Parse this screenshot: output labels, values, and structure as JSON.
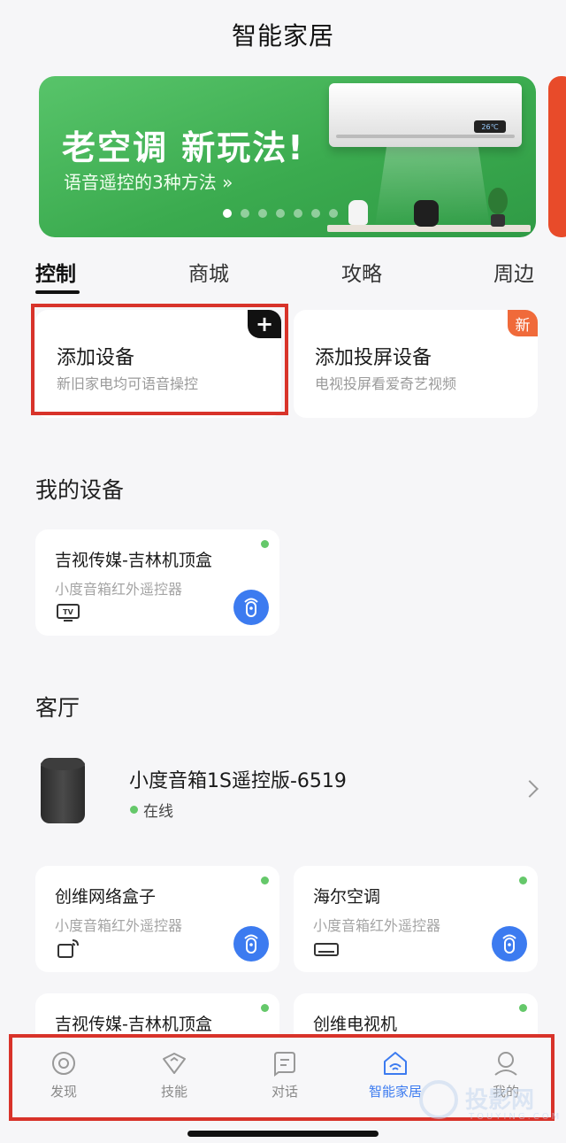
{
  "header": {
    "title": "智能家居"
  },
  "banner": {
    "title": "老空调 新玩法!",
    "subtitle": "语音遥控的3种方法 »",
    "ac_display": "26℃",
    "slide_count": 7,
    "active_slide": 1
  },
  "tabs": [
    {
      "label": "控制",
      "active": true
    },
    {
      "label": "商城",
      "active": false
    },
    {
      "label": "攻略",
      "active": false
    },
    {
      "label": "周边",
      "active": false
    }
  ],
  "quick_actions": {
    "add_device": {
      "title": "添加设备",
      "subtitle": "新旧家电均可语音操控",
      "badge": "+"
    },
    "add_screen": {
      "title": "添加投屏设备",
      "subtitle": "电视投屏看爱奇艺视频",
      "badge": "新"
    }
  },
  "my_devices": {
    "title": "我的设备",
    "items": [
      {
        "name": "吉视传媒-吉林机顶盒",
        "type": "小度音箱红外遥控器",
        "icon": "tv-icon",
        "online": true
      }
    ]
  },
  "living_room": {
    "title": "客厅",
    "speaker": {
      "name": "小度音箱1S遥控版-6519",
      "status": "在线"
    },
    "devices": [
      {
        "name": "创维网络盒子",
        "type": "小度音箱红外遥控器",
        "icon": "network-box-icon",
        "online": true
      },
      {
        "name": "海尔空调",
        "type": "小度音箱红外遥控器",
        "icon": "air-conditioner-icon",
        "online": true
      },
      {
        "name": "吉视传媒-吉林机顶盒",
        "type": "",
        "icon": "set-top-box-icon",
        "online": true
      },
      {
        "name": "创维电视机",
        "type": "",
        "icon": "tv-icon",
        "online": true
      }
    ]
  },
  "bottom_nav": [
    {
      "label": "发现",
      "icon": "discover-icon",
      "active": false
    },
    {
      "label": "技能",
      "icon": "skills-icon",
      "active": false
    },
    {
      "label": "对话",
      "icon": "chat-icon",
      "active": false
    },
    {
      "label": "智能家居",
      "icon": "smart-home-icon",
      "active": true
    },
    {
      "label": "我的",
      "icon": "profile-icon",
      "active": false
    }
  ],
  "watermark": {
    "text": "投影网",
    "sub": "TOUYING.COM"
  },
  "colors": {
    "accent": "#3c7bf0",
    "online": "#65c86a",
    "highlight_frame": "#d8332a",
    "banner_green": "#3bab4f"
  }
}
